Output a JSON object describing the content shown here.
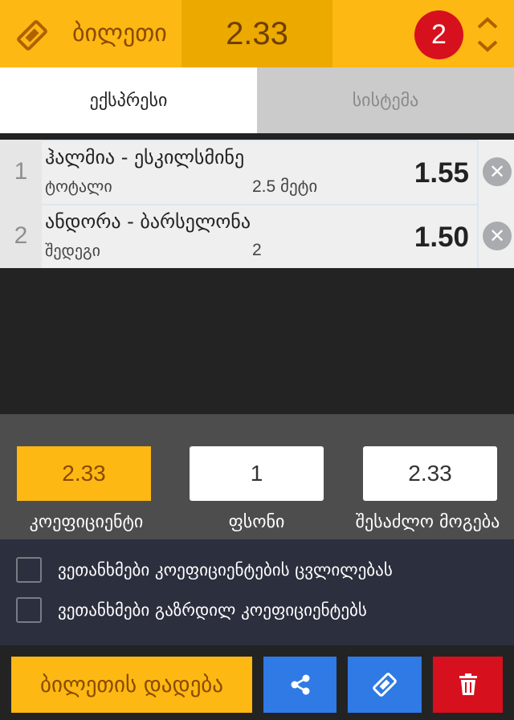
{
  "header": {
    "title": "ბილეთი",
    "total_odds": "2.33",
    "bet_count": "2",
    "ticket_icon": "ticket-icon",
    "expand_icon": "expand-collapse-icon"
  },
  "tabs": [
    {
      "label": "ექსპრესი",
      "active": true
    },
    {
      "label": "სისტემა",
      "active": false
    }
  ],
  "bets": [
    {
      "index": "1",
      "teams": "ჰალმია - ესკილსმინე",
      "market": "ტოტალი",
      "pick": "2.5 მეტი",
      "odd": "1.55"
    },
    {
      "index": "2",
      "teams": "ანდორა - ბარსელონა",
      "market": "შედეგი",
      "pick": "2",
      "odd": "1.50"
    }
  ],
  "summary": {
    "coef_value": "2.33",
    "coef_label": "კოეფიციენტი",
    "stake_value": "1",
    "stake_label": "ფსონი",
    "win_value": "2.33",
    "win_label": "შესაძლო მოგება"
  },
  "agreements": [
    {
      "label": "ვეთანხმები კოეფიციენტების ცვლილებას",
      "checked": false
    },
    {
      "label": "ვეთანხმები გაზრდილ კოეფიციენტებს",
      "checked": false
    }
  ],
  "footer": {
    "place_label": "ბილეთის დადება",
    "share_icon": "share-icon",
    "ticket_icon": "ticket-icon",
    "trash_icon": "trash-icon"
  },
  "colors": {
    "brand_yellow": "#FDB813",
    "odds_dark_yellow": "#ECA900",
    "badge_red": "#D7101E",
    "action_blue": "#2F7AE5"
  }
}
